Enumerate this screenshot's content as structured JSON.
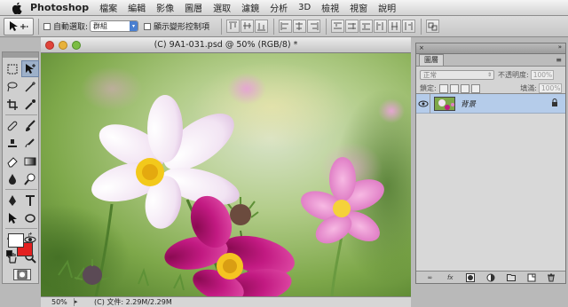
{
  "menubar": {
    "app": "Photoshop",
    "items": [
      "檔案",
      "編輯",
      "影像",
      "圖層",
      "選取",
      "濾鏡",
      "分析",
      "3D",
      "檢視",
      "視窗",
      "說明"
    ]
  },
  "options": {
    "auto_select_label": "自動選取:",
    "auto_select_value": "群組",
    "show_transform_label": "顯示變形控制項"
  },
  "document": {
    "title": "(C) 9A1-031.psd @ 50% (RGB/8) *",
    "zoom": "50%",
    "status": "(C) 文件: 2.29M/2.29M"
  },
  "layers_panel": {
    "tab": "圖層",
    "blend_mode": "正常",
    "opacity_label": "不透明度:",
    "opacity_value": "100%",
    "lock_label": "鎖定:",
    "fill_label": "填滿:",
    "fill_value": "100%",
    "layer_name": "背景"
  },
  "colors": {
    "foreground": "#ffffff",
    "background": "#e32020",
    "accent": "#3c7fd9",
    "layer_selected": "#b5ccea"
  }
}
